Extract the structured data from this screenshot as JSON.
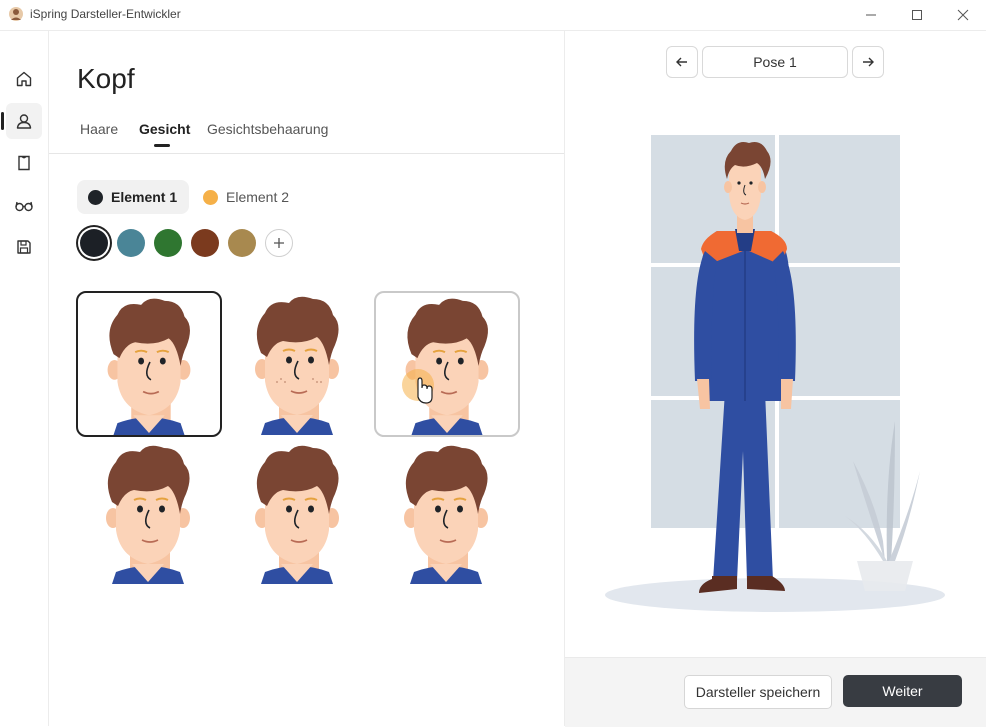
{
  "window": {
    "title": "iSpring Darsteller-Entwickler"
  },
  "sidebar": {
    "items": [
      {
        "icon": "home-icon"
      },
      {
        "icon": "user-icon",
        "active": true
      },
      {
        "icon": "clothing-icon"
      },
      {
        "icon": "glasses-icon"
      },
      {
        "icon": "save-icon"
      }
    ]
  },
  "main": {
    "title": "Kopf",
    "tabs": [
      {
        "label": "Haare"
      },
      {
        "label": "Gesicht",
        "active": true
      },
      {
        "label": "Gesichtsbehaarung"
      }
    ],
    "elements": [
      {
        "label": "Element 1",
        "color": "#1f2328",
        "active": true
      },
      {
        "label": "Element 2",
        "color": "#f5b048"
      }
    ],
    "swatches": [
      "#1c2026",
      "#4a8597",
      "#2f7630",
      "#7b3a1e",
      "#a8894f"
    ],
    "selected_swatch": 0,
    "add_swatch_icon": "plus-icon",
    "face_options": [
      {
        "variant": "face-1",
        "selected": true
      },
      {
        "variant": "face-2"
      },
      {
        "variant": "face-3",
        "hover": true
      },
      {
        "variant": "face-4"
      },
      {
        "variant": "face-5"
      },
      {
        "variant": "face-6"
      }
    ]
  },
  "preview": {
    "pose_label": "Pose 1",
    "prev_icon": "arrow-left-icon",
    "next_icon": "arrow-right-icon"
  },
  "footer": {
    "save_label": "Darsteller speichern",
    "next_label": "Weiter"
  },
  "colors": {
    "hair": "#7a4533",
    "skin": "#fbd3b8",
    "suit": "#2f4ea2",
    "suit_accent": "#f06a33",
    "backdrop": "#d5dde4",
    "button_dark": "#383c42"
  }
}
